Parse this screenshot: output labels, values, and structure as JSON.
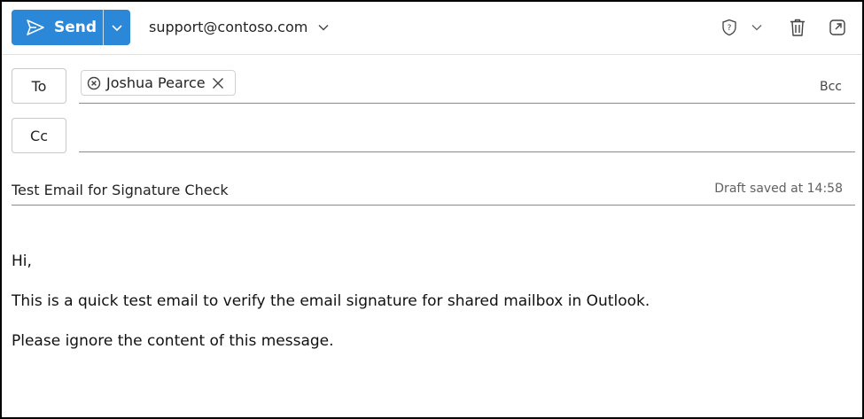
{
  "toolbar": {
    "send_label": "Send",
    "from_address": "support@contoso.com",
    "icons": [
      "send-icon",
      "chevron-down-icon",
      "sensitivity-shield-icon",
      "trash-icon",
      "pop-out-icon"
    ]
  },
  "recipients": {
    "to_label": "To",
    "cc_label": "Cc",
    "bcc_label": "Bcc",
    "to_chips": [
      {
        "name": "Joshua Pearce"
      }
    ],
    "cc_value": ""
  },
  "subject": {
    "value": "Test Email for Signature Check",
    "draft_status": "Draft saved at 14:58"
  },
  "body": {
    "lines": [
      "Hi,",
      "This is a quick test email to verify the email signature for shared mailbox in Outlook.",
      "Please ignore the content of this message."
    ]
  },
  "colors": {
    "accent": "#2b88d8",
    "text": "#242424",
    "muted": "#616161"
  }
}
